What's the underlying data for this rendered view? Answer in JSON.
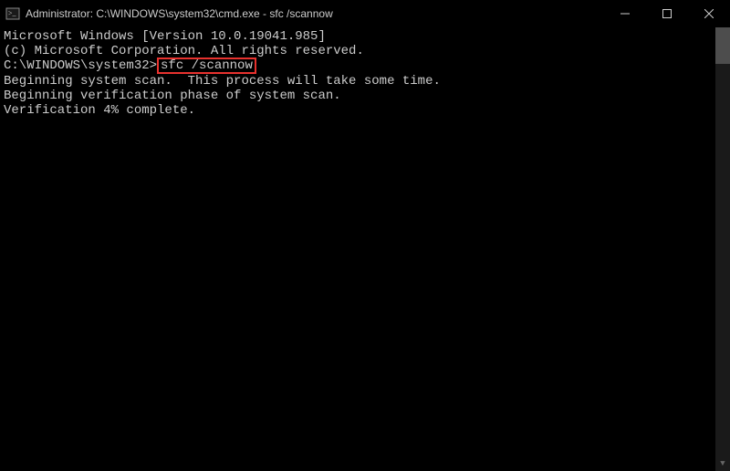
{
  "titlebar": {
    "title": "Administrator: C:\\WINDOWS\\system32\\cmd.exe - sfc  /scannow"
  },
  "console": {
    "line1": "Microsoft Windows [Version 10.0.19041.985]",
    "line2": "(c) Microsoft Corporation. All rights reserved.",
    "blank1": "",
    "prompt": "C:\\WINDOWS\\system32>",
    "command": "sfc /scannow",
    "blank2": "",
    "line3": "Beginning system scan.  This process will take some time.",
    "blank3": "",
    "line4": "Beginning verification phase of system scan.",
    "line5": "Verification 4% complete."
  }
}
